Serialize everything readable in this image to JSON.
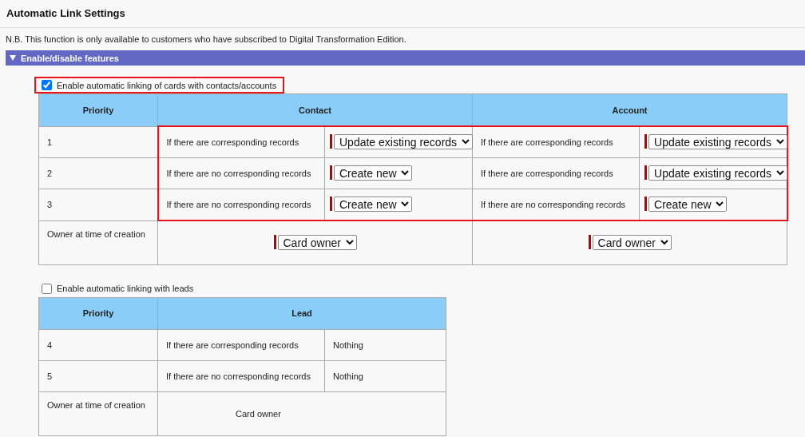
{
  "page": {
    "title": "Automatic Link Settings",
    "note": "N.B. This function is only available to customers who have subscribed to Digital Transformation Edition."
  },
  "section": {
    "title": "Enable/disable features",
    "expanded": true
  },
  "contact_account": {
    "checkbox": {
      "label": "Enable automatic linking of cards with contacts/accounts",
      "checked": true,
      "highlighted": true
    },
    "columns": [
      "Priority",
      "Contact",
      "Account"
    ],
    "rows": [
      {
        "priority": "1",
        "highlighted": true,
        "contact": {
          "condition": "If there are corresponding records",
          "action": "Update existing records"
        },
        "account": {
          "condition": "If there are corresponding records",
          "action": "Update existing records"
        }
      },
      {
        "priority": "2",
        "highlighted": true,
        "contact": {
          "condition": "If there are no corresponding records",
          "action": "Create new"
        },
        "account": {
          "condition": "If there are corresponding records",
          "action": "Update existing records"
        }
      },
      {
        "priority": "3",
        "highlighted": true,
        "contact": {
          "condition": "If there are no corresponding records",
          "action": "Create new"
        },
        "account": {
          "condition": "If there are no corresponding records",
          "action": "Create new"
        }
      }
    ],
    "owner": {
      "label": "Owner at time of creation",
      "contact": "Card owner",
      "account": "Card owner"
    }
  },
  "leads": {
    "checkbox": {
      "label": "Enable automatic linking with leads",
      "checked": false,
      "highlighted": false
    },
    "columns": [
      "Priority",
      "Lead"
    ],
    "rows": [
      {
        "priority": "4",
        "condition": "If there are corresponding records",
        "action": "Nothing"
      },
      {
        "priority": "5",
        "condition": "If there are no corresponding records",
        "action": "Nothing"
      }
    ],
    "owner": {
      "label": "Owner at time of creation",
      "value": "Card owner"
    }
  }
}
